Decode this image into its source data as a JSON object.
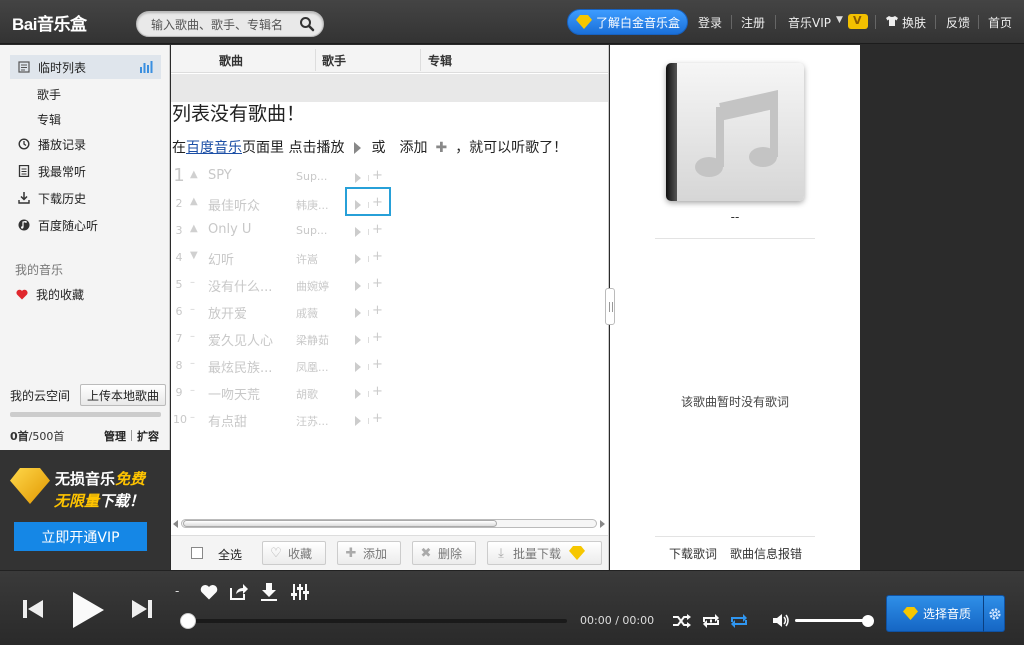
{
  "header": {
    "logo": "Bai音乐盒",
    "search_placeholder": "输入歌曲、歌手、专辑名",
    "platinum_label": "了解白金音乐盒",
    "links": {
      "login": "登录",
      "register": "注册",
      "vip": "音乐VIP",
      "vip_badge": "V",
      "skin": "换肤",
      "feedback": "反馈",
      "home": "首页"
    }
  },
  "sidebar": {
    "current_list": "临时列表",
    "singer": "歌手",
    "album": "专辑",
    "play_history": "播放记录",
    "most_played": "我最常听",
    "download_history": "下载历史",
    "baidu_random": "百度随心听",
    "my_music_title": "我的音乐",
    "favorites": "我的收藏"
  },
  "cloud": {
    "title": "我的云空间",
    "upload_label": "上传本地歌曲",
    "used": "0首",
    "total": "/500首",
    "manage": "管理",
    "expand": "扩容",
    "quota_fraction": 0
  },
  "promo": {
    "line1_a": "无损音乐",
    "line1_b": "免费",
    "line2_a": "无限量",
    "line2_b": "下载！",
    "button": "立即开通VIP"
  },
  "playlist": {
    "columns": {
      "song": "歌曲",
      "artist": "歌手",
      "album": "专辑"
    },
    "empty_title": "列表没有歌曲！",
    "hint": {
      "prefix": "在",
      "link": "百度音乐",
      "middle": "页面里 点击播放",
      "or": "或",
      "add": "添加",
      "suffix": "，就可以听歌了！"
    },
    "songs": [
      {
        "num": "1",
        "trend": "▲",
        "title": "SPY",
        "artist": "Sup..."
      },
      {
        "num": "2",
        "trend": "▲",
        "title": "最佳听众",
        "artist": "韩庚..."
      },
      {
        "num": "3",
        "trend": "▲",
        "title": "Only U",
        "artist": "Sup..."
      },
      {
        "num": "4",
        "trend": "▼",
        "title": "幻听",
        "artist": "许嵩"
      },
      {
        "num": "5",
        "trend": "–",
        "title": "没有什么...",
        "artist": "曲婉婷"
      },
      {
        "num": "6",
        "trend": "–",
        "title": "放开爱",
        "artist": "戚薇"
      },
      {
        "num": "7",
        "trend": "–",
        "title": "爱久见人心",
        "artist": "梁静茹"
      },
      {
        "num": "8",
        "trend": "–",
        "title": "最炫民族...",
        "artist": "凤凰..."
      },
      {
        "num": "9",
        "trend": "–",
        "title": "一吻天荒",
        "artist": "胡歌"
      },
      {
        "num": "10",
        "trend": "–",
        "title": "有点甜",
        "artist": "汪苏..."
      }
    ],
    "toolbar": {
      "select_all": "全选",
      "favorite": "收藏",
      "add": "添加",
      "delete": "删除",
      "batch_download": "批量下载"
    }
  },
  "right_panel": {
    "song_placeholder": "--",
    "no_lyrics": "该歌曲暂时没有歌词",
    "download_lyrics": "下载歌词",
    "report_error": "歌曲信息报错"
  },
  "player": {
    "song_dash": "-",
    "time": "00:00 / 00:00",
    "progress": 0,
    "volume": 1,
    "quality_label": "选择音质"
  },
  "colors": {
    "accent_blue": "#1587e6",
    "vip_gold": "#f6c700",
    "highlight_border": "#27a0d8",
    "heart_red": "#e0282e"
  }
}
